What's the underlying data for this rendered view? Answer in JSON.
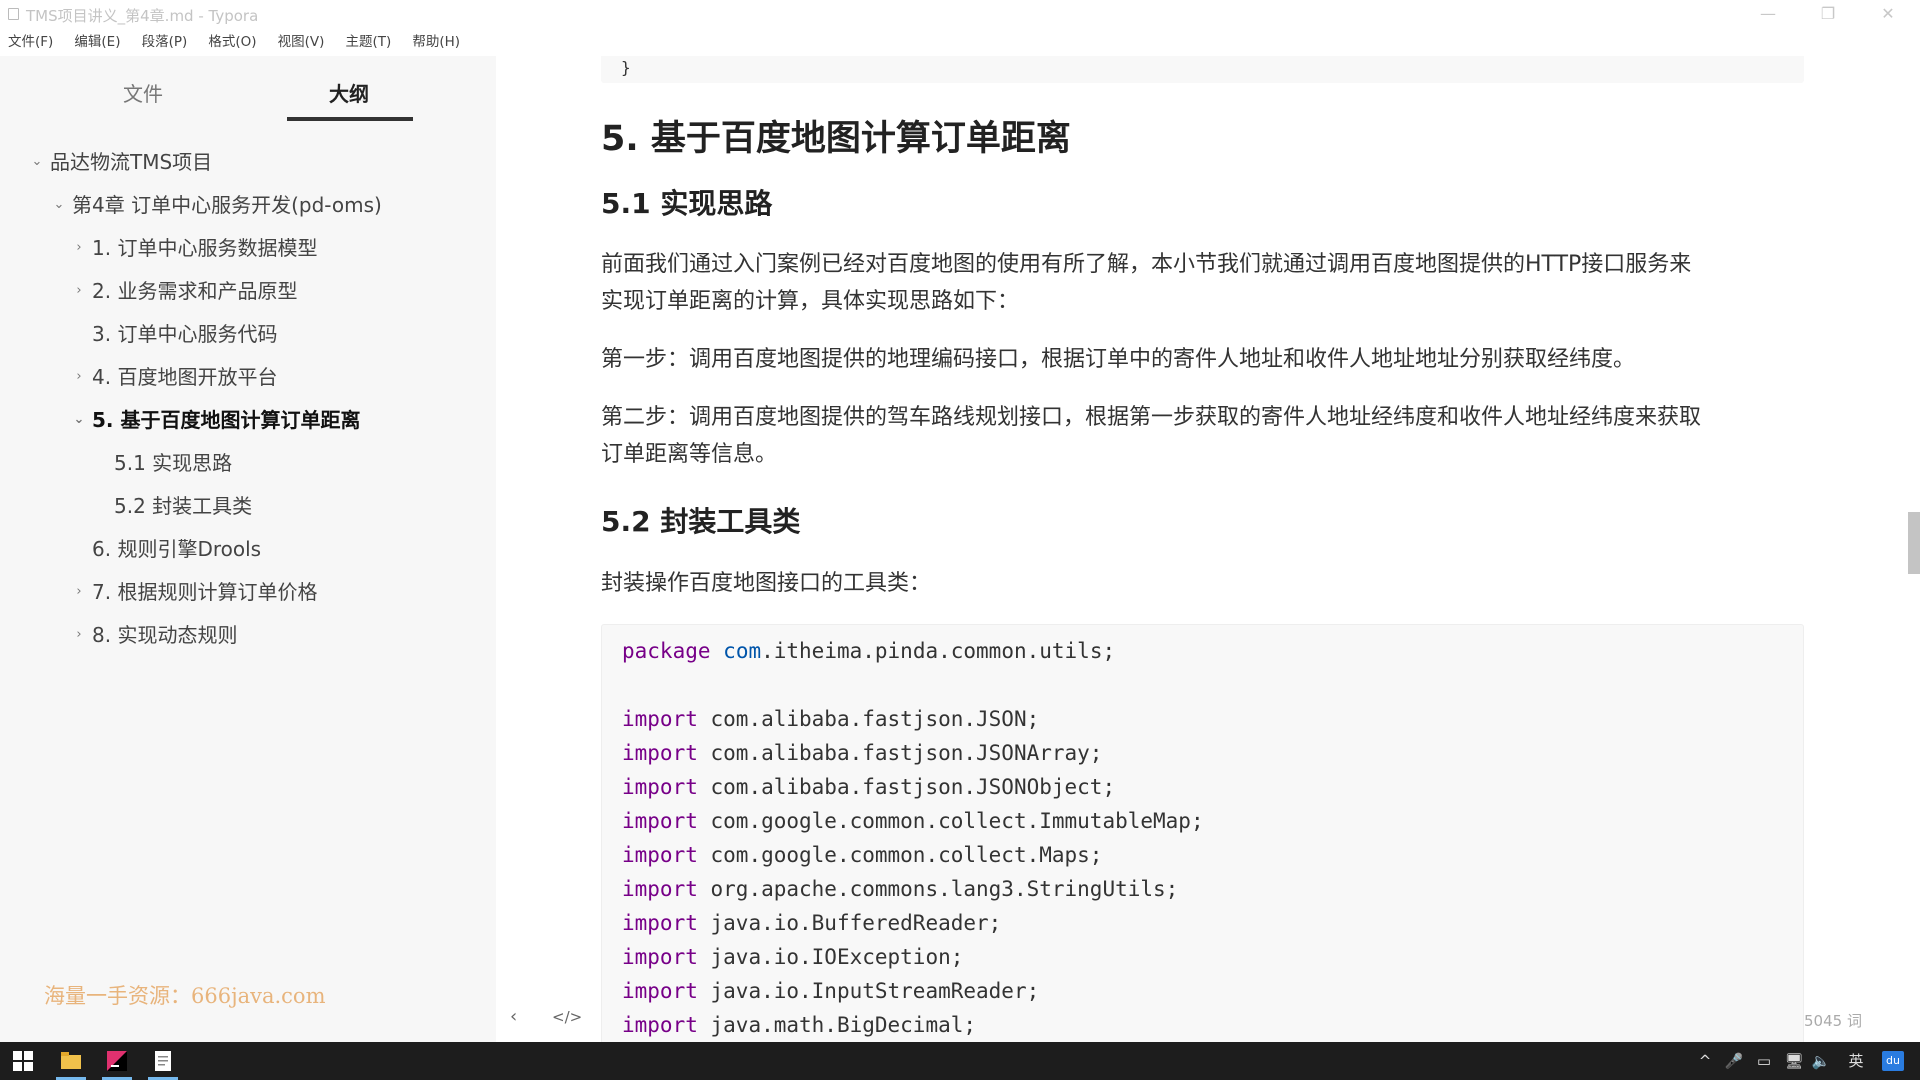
{
  "window": {
    "title": "TMS项目讲义_第4章.md - Typora",
    "controls": [
      "—",
      "❐",
      "✕"
    ]
  },
  "menubar": [
    "文件(F)",
    "编辑(E)",
    "段落(P)",
    "格式(O)",
    "视图(V)",
    "主题(T)",
    "帮助(H)"
  ],
  "sidebar": {
    "tabs": [
      "文件",
      "大纲"
    ],
    "active_tab": "大纲",
    "outline": [
      {
        "label": "品达物流TMS项目",
        "caret": "⌄",
        "level": 0
      },
      {
        "label": "第4章 订单中心服务开发(pd-oms)",
        "caret": "⌄",
        "level": 1
      },
      {
        "label": "1. 订单中心服务数据模型",
        "caret": "›",
        "level": 2
      },
      {
        "label": "2. 业务需求和产品原型",
        "caret": "›",
        "level": 2
      },
      {
        "label": "3. 订单中心服务代码",
        "caret": "",
        "level": 2
      },
      {
        "label": "4. 百度地图开放平台",
        "caret": "›",
        "level": 2
      },
      {
        "label": "5. 基于百度地图计算订单距离",
        "caret": "⌄",
        "level": 2,
        "active": true
      },
      {
        "label": "5.1 实现思路",
        "caret": "",
        "level": 3
      },
      {
        "label": "5.2 封装工具类",
        "caret": "",
        "level": 3
      },
      {
        "label": "6. 规则引擎Drools",
        "caret": "",
        "level": 2
      },
      {
        "label": "7. 根据规则计算订单价格",
        "caret": "›",
        "level": 2
      },
      {
        "label": "8. 实现动态规则",
        "caret": "›",
        "level": 2
      }
    ],
    "watermark": "海量一手资源：666java.com",
    "tools": [
      "‹",
      "</>"
    ]
  },
  "content": {
    "prev_code_tail": "}",
    "h2": "5. 基于百度地图计算订单距离",
    "h3_1": "5.1 实现思路",
    "p1_line1": "前面我们通过入门案例已经对百度地图的使用有所了解，本小节我们就通过调用百度地图提供的HTTP接口服务来",
    "p1_line2": "实现订单距离的计算，具体实现思路如下：",
    "p2": "第一步：调用百度地图提供的地理编码接口，根据订单中的寄件人地址和收件人地址地址分别获取经纬度。",
    "p3_line1": "第二步：调用百度地图提供的驾车路线规划接口，根据第一步获取的寄件人地址经纬度和收件人地址经纬度来获取",
    "p3_line2": "订单距离等信息。",
    "h3_2": "5.2 封装工具类",
    "p4": "封装操作百度地图接口的工具类：",
    "code": {
      "package_kw": "package",
      "package_head": "com",
      "package_rest": ".itheima.pinda.common.utils;",
      "import_kw": "import",
      "imports": [
        "com.alibaba.fastjson.JSON;",
        "com.alibaba.fastjson.JSONArray;",
        "com.alibaba.fastjson.JSONObject;",
        "com.google.common.collect.ImmutableMap;",
        "com.google.common.collect.Maps;",
        "org.apache.commons.lang3.StringUtils;",
        "java.io.BufferedReader;",
        "java.io.IOException;",
        "java.io.InputStreamReader;",
        "java.math.BigDecimal;"
      ]
    }
  },
  "statusbar": {
    "word_count": "5045 词"
  },
  "taskbar": {
    "start_icon": "windows-start-icon",
    "apps": [
      "file-explorer-icon",
      "intellij-idea-icon",
      "typora-icon"
    ],
    "tray": [
      "^",
      "🎤",
      "▭",
      "🖥",
      "🔈",
      "英"
    ],
    "tray_badge": "du"
  },
  "colors": {
    "sidebar_bg": "#f7f7f7",
    "code_bg": "#f8f8f8",
    "keyword": "#770088",
    "package_name": "#0055aa",
    "watermark": "#e8b47c",
    "taskbar": "#1d1d1d"
  }
}
